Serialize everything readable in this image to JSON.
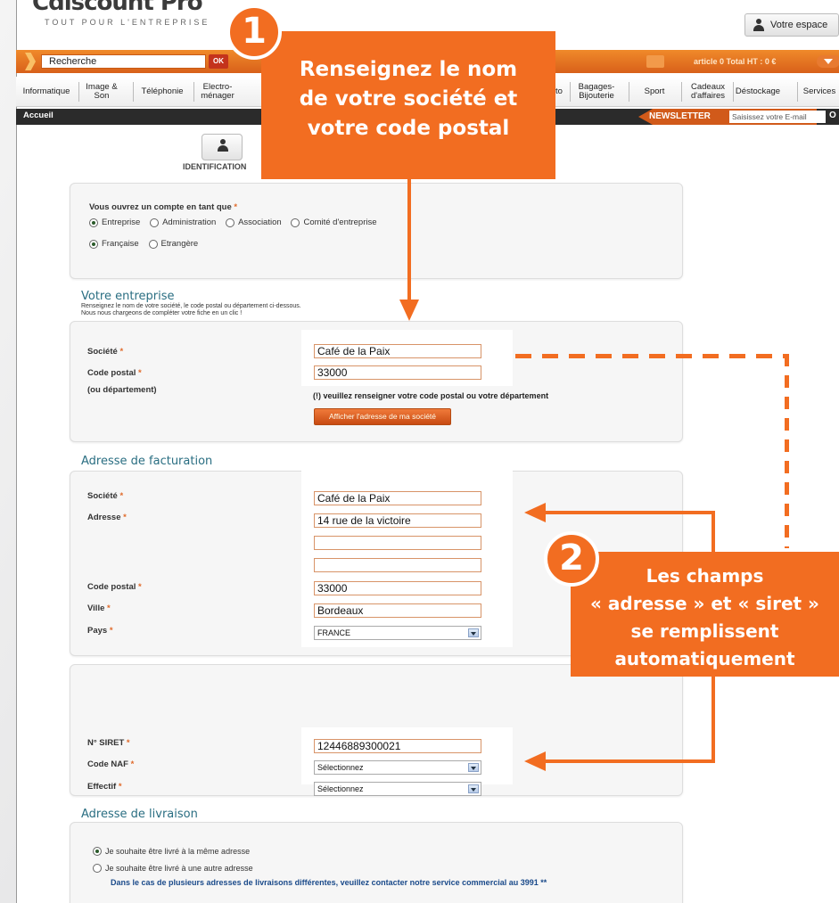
{
  "header": {
    "logo": "Cdiscount Pro",
    "tagline": "TOUT POUR L'ENTREPRISE",
    "espace_label": "Votre espace"
  },
  "searchbar": {
    "search_value": "Recherche",
    "ok_label": "OK",
    "cart_text": "article 0 Total HT : 0 €"
  },
  "categories": [
    "Informatique",
    "Image & Son",
    "Téléphonie",
    "Electro-ménager",
    "to",
    "Bagages-Bijouterie",
    "Sport",
    "Cadeaux d'affaires",
    "Déstockage",
    "Services"
  ],
  "breadcrumb": {
    "home": "Accueil"
  },
  "newsletter": {
    "label": "NEWSLETTER",
    "placeholder": "Saisissez votre E-mail",
    "ok": "O"
  },
  "steps": {
    "identification": "IDENTIFICATION"
  },
  "account_type": {
    "question": "Vous ouvrez un compte en tant que",
    "options": [
      "Entreprise",
      "Administration",
      "Association",
      "Comité d'entreprise"
    ],
    "nationality": [
      "Française",
      "Etrangère"
    ]
  },
  "votre_entreprise": {
    "title": "Votre entreprise",
    "desc1": "Renseignez le nom de votre société, le code postal ou département ci-dessous.",
    "desc2": "Nous nous chargeons de compléter votre fiche en un clic !",
    "societe_label": "Société",
    "cp_label": "Code postal",
    "dept_label": "(ou département)",
    "societe_value": "Café de la Paix",
    "cp_value": "33000",
    "hint": "(!) veuillez renseigner votre code postal ou votre département",
    "button": "Afficher l'adresse de ma société"
  },
  "facturation": {
    "title": "Adresse de facturation",
    "societe_label": "Société",
    "adresse_label": "Adresse",
    "cp_label": "Code postal",
    "ville_label": "Ville",
    "pays_label": "Pays",
    "societe_value": "Café de la Paix",
    "adresse_value": "14 rue de la victoire",
    "adresse2_value": "",
    "adresse3_value": "",
    "cp_value": "33000",
    "ville_value": "Bordeaux",
    "pays_value": "FRANCE"
  },
  "siret_section": {
    "siret_label": "N° SIRET",
    "naf_label": "Code NAF",
    "effectif_label": "Effectif",
    "siret_value": "12446889300021",
    "naf_value": "Sélectionnez",
    "effectif_value": "Sélectionnez"
  },
  "livraison": {
    "title": "Adresse de livraison",
    "opt1": "Je souhaite être livré à la même adresse",
    "opt2": "Je souhaite être livré à une autre adresse",
    "note": "Dans le cas de plusieurs adresses de livraisons différentes, veuillez contacter notre service commercial au 3991 **"
  },
  "callout1": {
    "number": "1",
    "line1": "Renseignez  le nom",
    "line2": "de votre  société et",
    "line3": "votre code postal"
  },
  "callout2": {
    "number": "2",
    "line1": "Les champs",
    "line2": "« adresse » et « siret »",
    "line3": "se remplissent",
    "line4": "automatiquement"
  },
  "colors": {
    "accent": "#f26d21",
    "section_title": "#2a6e82"
  }
}
